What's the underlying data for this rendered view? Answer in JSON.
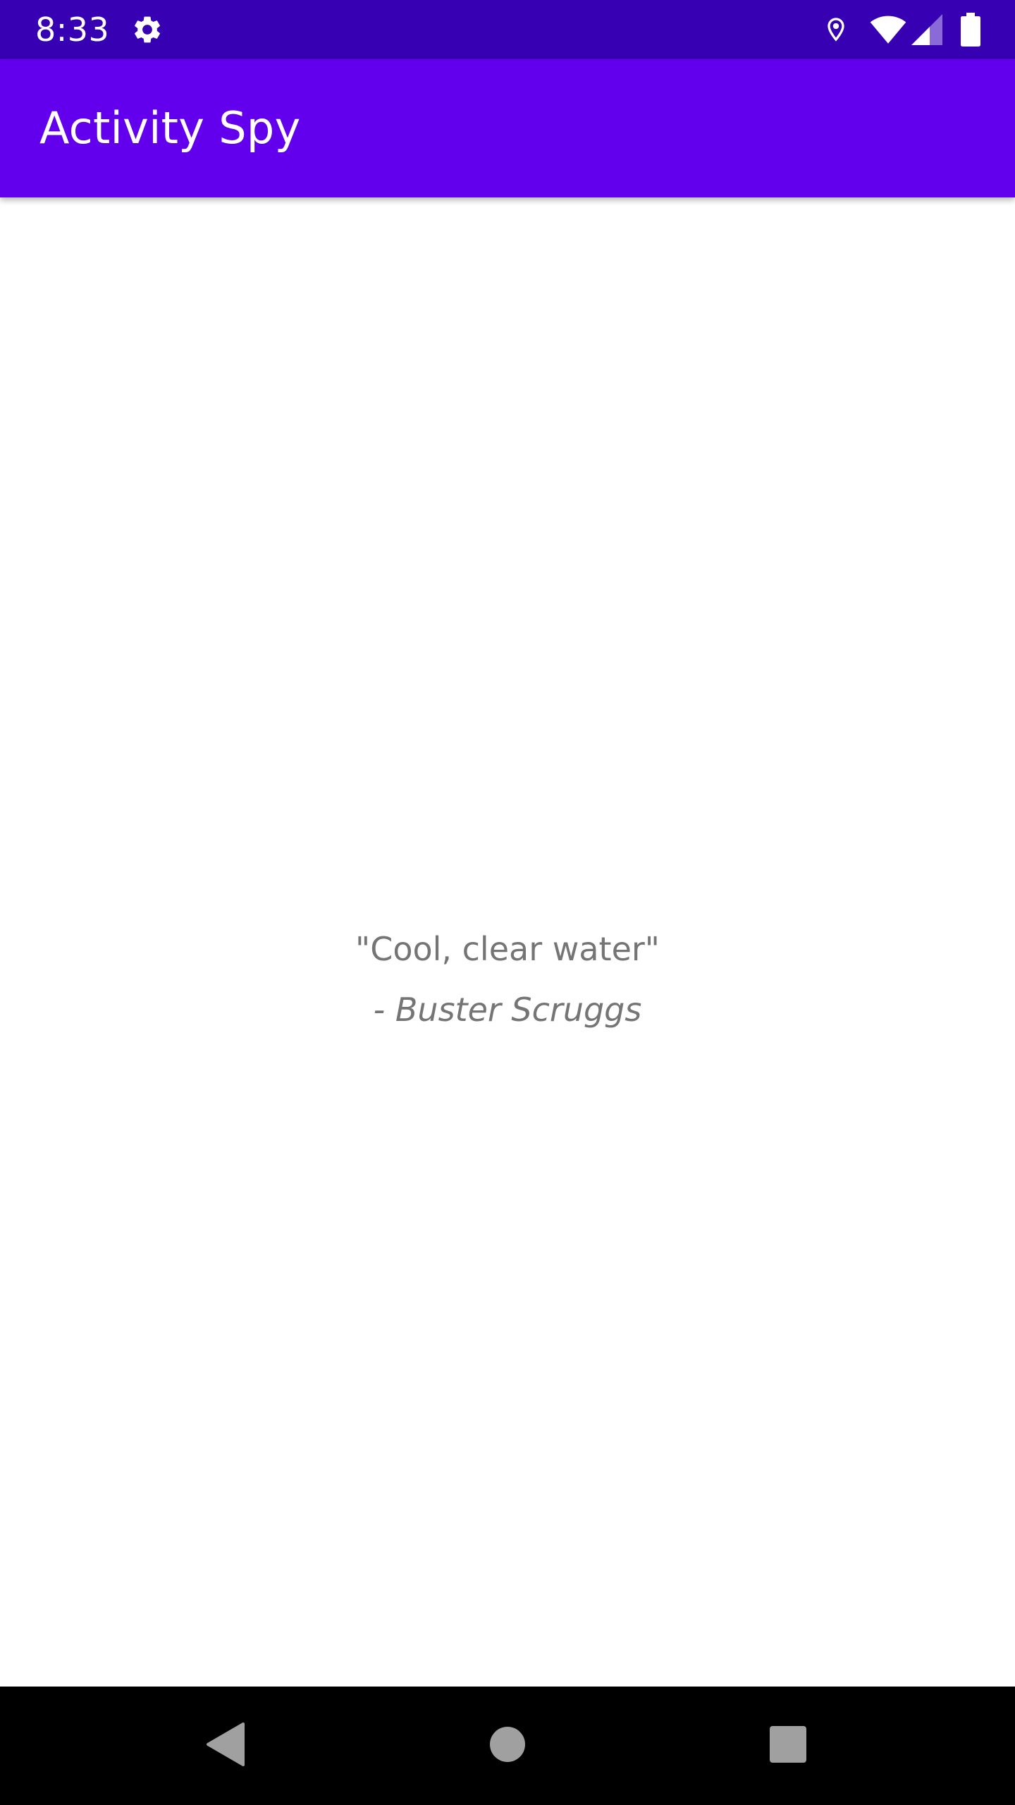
{
  "status_bar": {
    "time": "8:33",
    "icons": [
      "settings-gear-icon",
      "location-icon",
      "wifi-icon",
      "cell-signal-icon",
      "battery-icon"
    ],
    "background_color": "#3700B3"
  },
  "app_bar": {
    "title": "Activity Spy",
    "background_color": "#6200EE"
  },
  "content": {
    "quote": "\"Cool, clear water\"",
    "author": "- Buster Scruggs",
    "text_color": "#757575"
  },
  "nav_bar": {
    "buttons": [
      "back-icon",
      "home-icon",
      "recents-icon"
    ],
    "background_color": "#000000"
  }
}
